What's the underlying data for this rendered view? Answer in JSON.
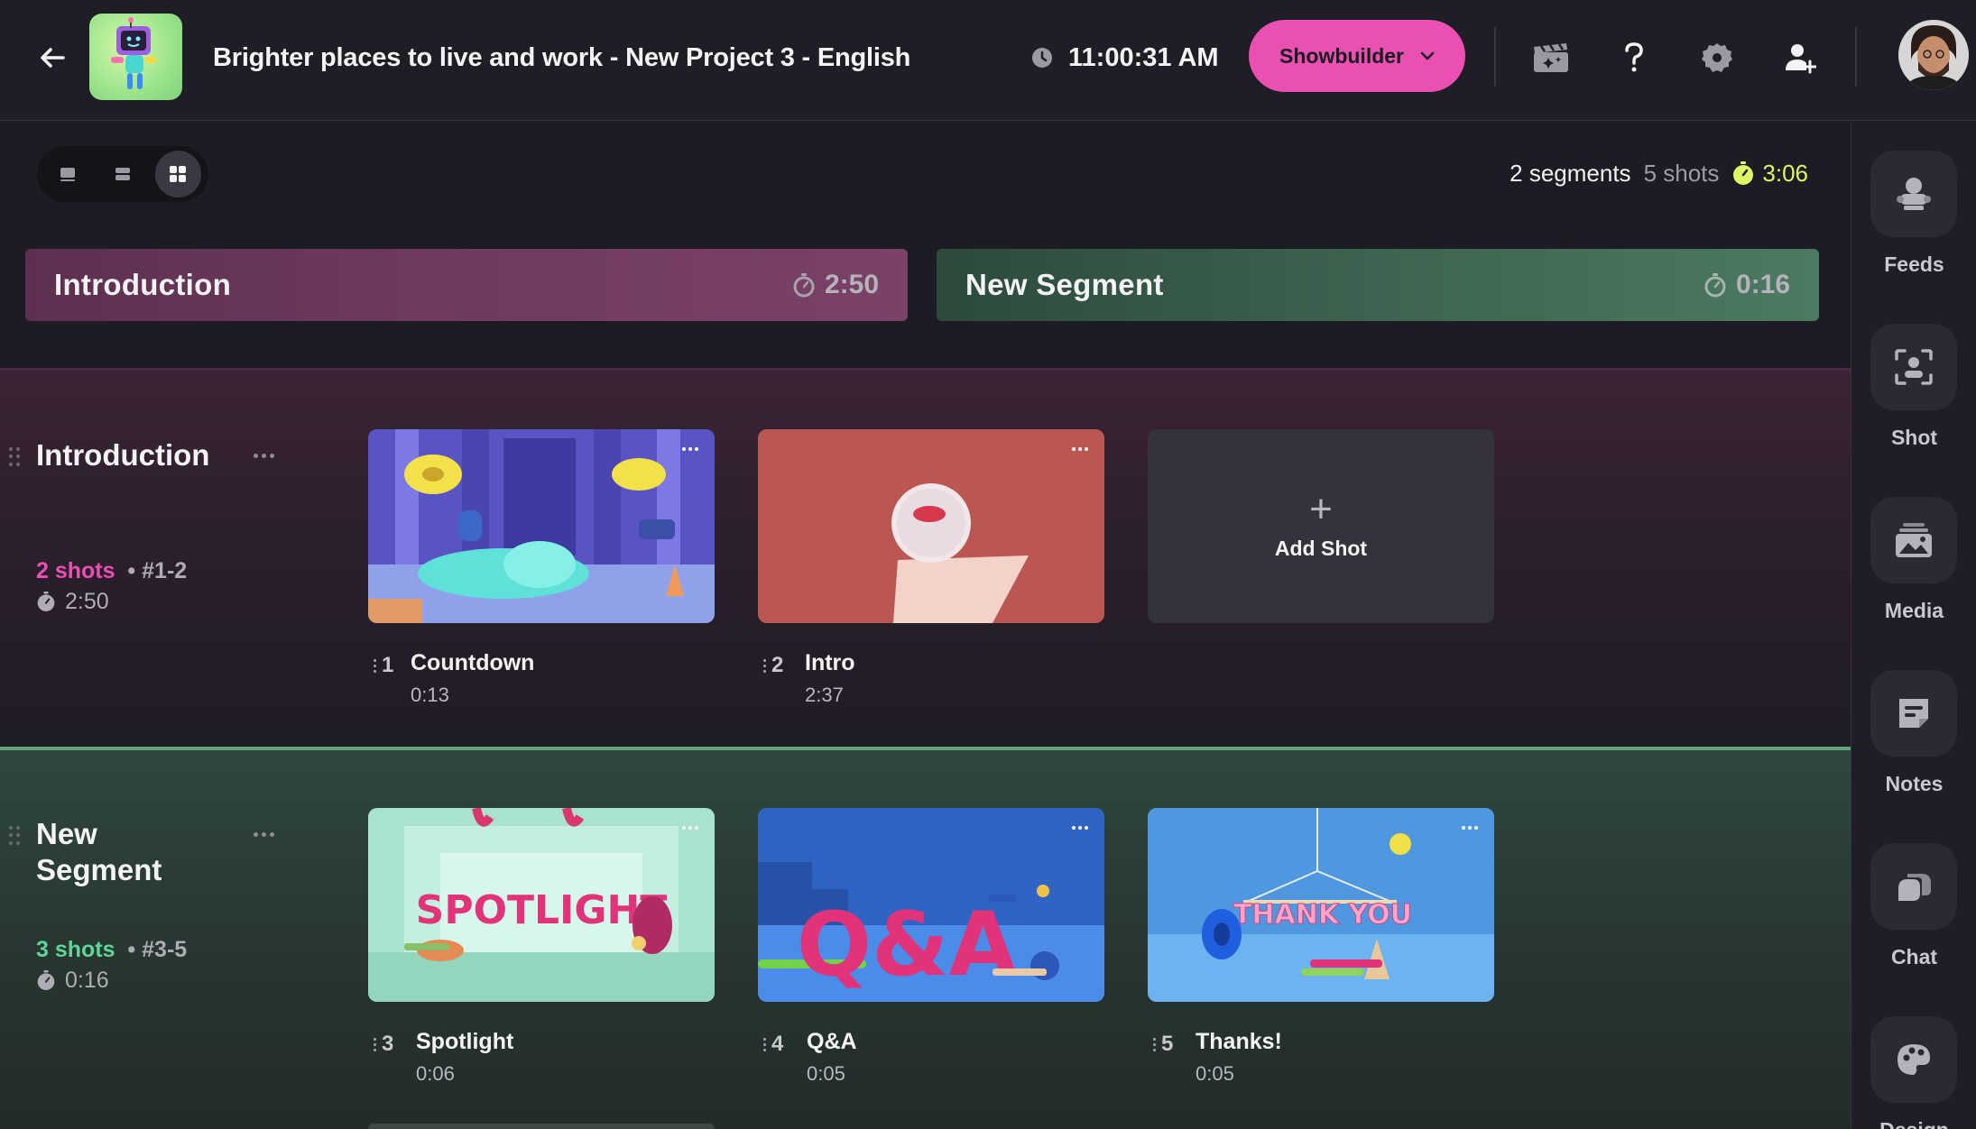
{
  "header": {
    "project_title": "Brighter places to live and work - New Project 3 - English",
    "clock": "11:00:31 AM",
    "showbuilder_label": "Showbuilder",
    "icons": [
      "back-arrow-icon",
      "clock-icon",
      "chevron-down-icon",
      "clapperboard-sparkle-icon",
      "help-icon",
      "settings-gear-icon",
      "add-user-icon"
    ]
  },
  "toolbar": {
    "views": [
      "single-view-icon",
      "list-view-icon",
      "grid-view-icon"
    ],
    "active_view": "grid-view-icon",
    "summary": {
      "segments": "2 segments",
      "shots": "5 shots",
      "duration": "3:06"
    }
  },
  "segment_tabs": [
    {
      "name": "Introduction",
      "duration": "2:50",
      "color": "#6f3a5e"
    },
    {
      "name": "New Segment",
      "duration": "0:16",
      "color": "#3d6450"
    }
  ],
  "segments": [
    {
      "title": "Introduction",
      "shot_count": "2 shots",
      "range": "#1-2",
      "duration": "2:50",
      "accent": "#ea4fb2",
      "shots": [
        {
          "number": "1",
          "name": "Countdown",
          "duration": "0:13"
        },
        {
          "number": "2",
          "name": "Intro",
          "duration": "2:37"
        }
      ],
      "add_shot_label": "Add Shot"
    },
    {
      "title_line1": "New",
      "title_line2": "Segment",
      "shot_count": "3 shots",
      "range": "#3-5",
      "duration": "0:16",
      "accent": "#5fd49a",
      "shots": [
        {
          "number": "3",
          "name": "Spotlight",
          "duration": "0:06",
          "thumb_text": "SPOTLIGHT"
        },
        {
          "number": "4",
          "name": "Q&A",
          "duration": "0:05",
          "thumb_text": "Q&A"
        },
        {
          "number": "5",
          "name": "Thanks!",
          "duration": "0:05",
          "thumb_text": "THANK YOU"
        }
      ]
    }
  ],
  "sidebar": {
    "items": [
      {
        "label": "Feeds",
        "icon": "feeds-icon"
      },
      {
        "label": "Shot",
        "icon": "shot-icon"
      },
      {
        "label": "Media",
        "icon": "media-icon"
      },
      {
        "label": "Notes",
        "icon": "notes-icon"
      },
      {
        "label": "Chat",
        "icon": "chat-icon"
      },
      {
        "label": "Design",
        "icon": "design-palette-icon"
      }
    ]
  },
  "colors": {
    "accent_pink": "#ea4fb2",
    "accent_green": "#5fd49a",
    "timer_yellow": "#dff566",
    "background": "#1d1c24"
  }
}
